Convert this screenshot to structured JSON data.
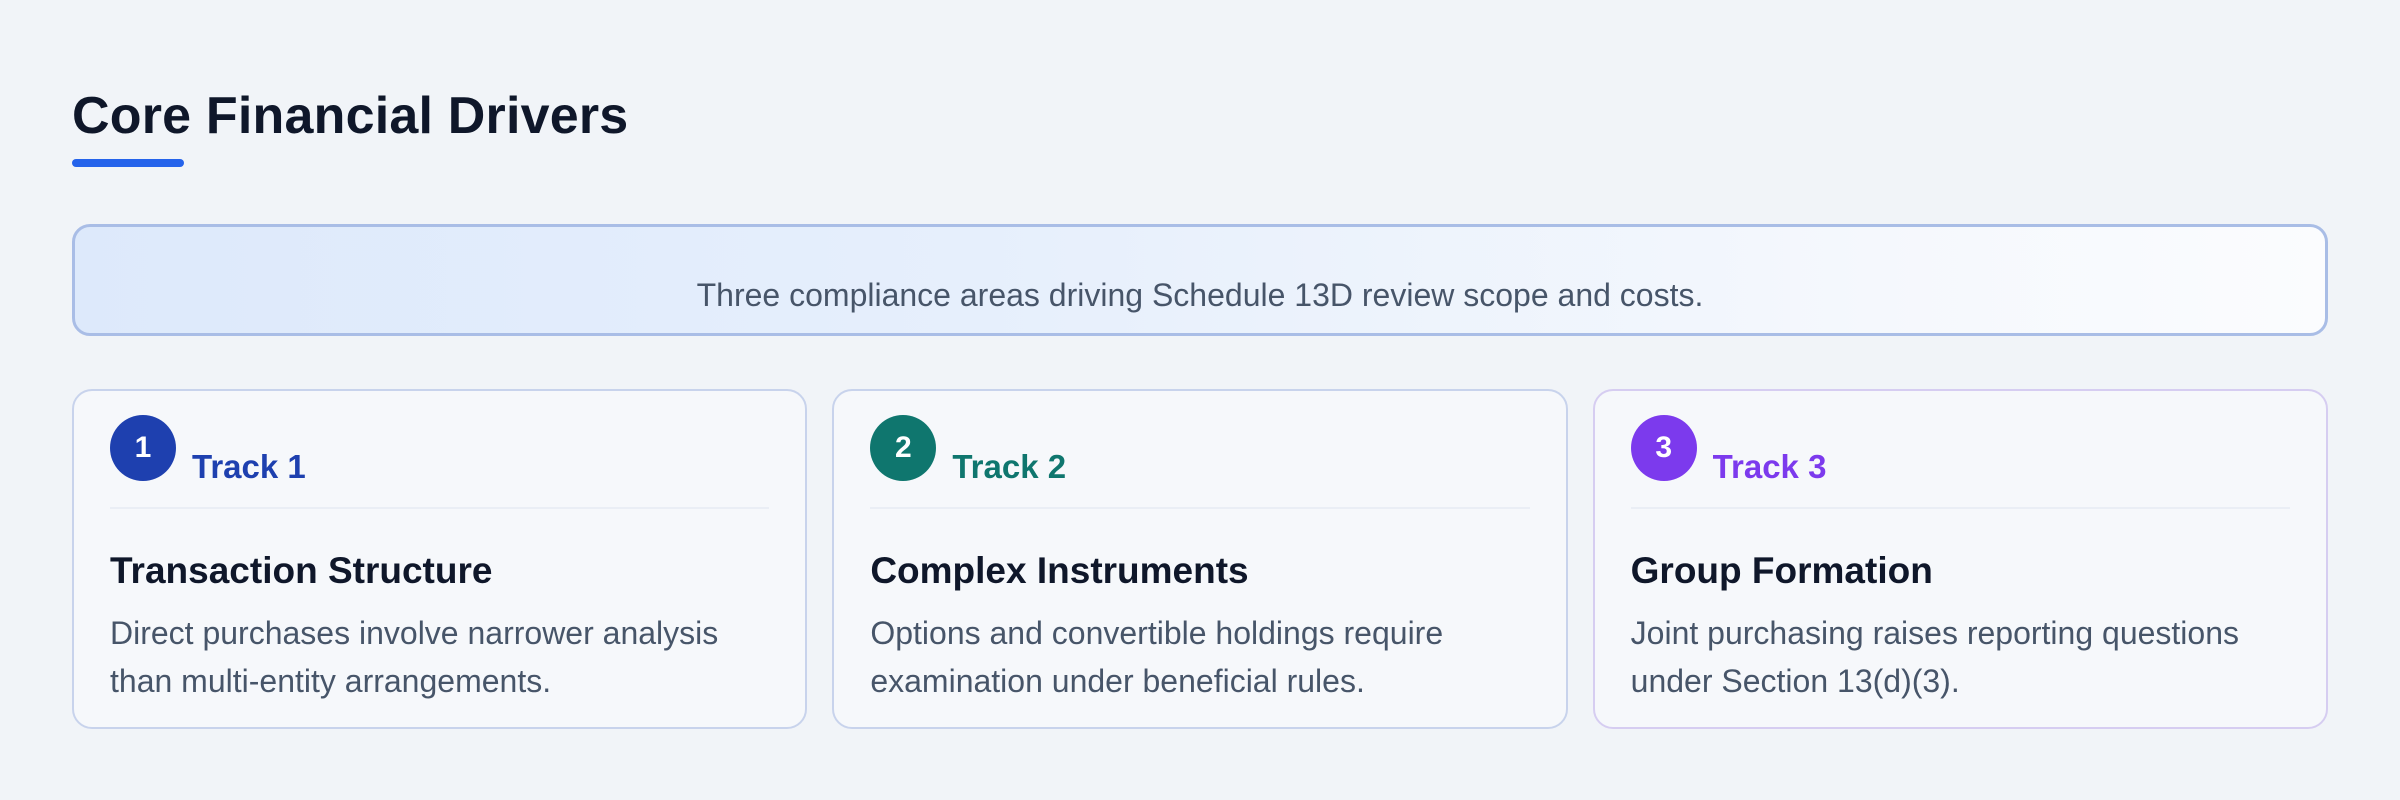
{
  "header": {
    "title": "Core Financial Drivers",
    "accent_color": "#2563eb"
  },
  "summary": {
    "text": "Three compliance areas driving Schedule 13D review scope and costs."
  },
  "cards": [
    {
      "number": "1",
      "track": "Track 1",
      "title": "Transaction Structure",
      "description": "Direct purchases involve narrower analysis than multi-entity arrangements.",
      "color": "#1e40af"
    },
    {
      "number": "2",
      "track": "Track 2",
      "title": "Complex Instruments",
      "description": "Options and convertible holdings require examination under beneficial rules.",
      "color": "#0f766e"
    },
    {
      "number": "3",
      "track": "Track 3",
      "title": "Group Formation",
      "description": "Joint purchasing raises reporting questions under Section 13(d)(3).",
      "color": "#7c3aed"
    }
  ]
}
